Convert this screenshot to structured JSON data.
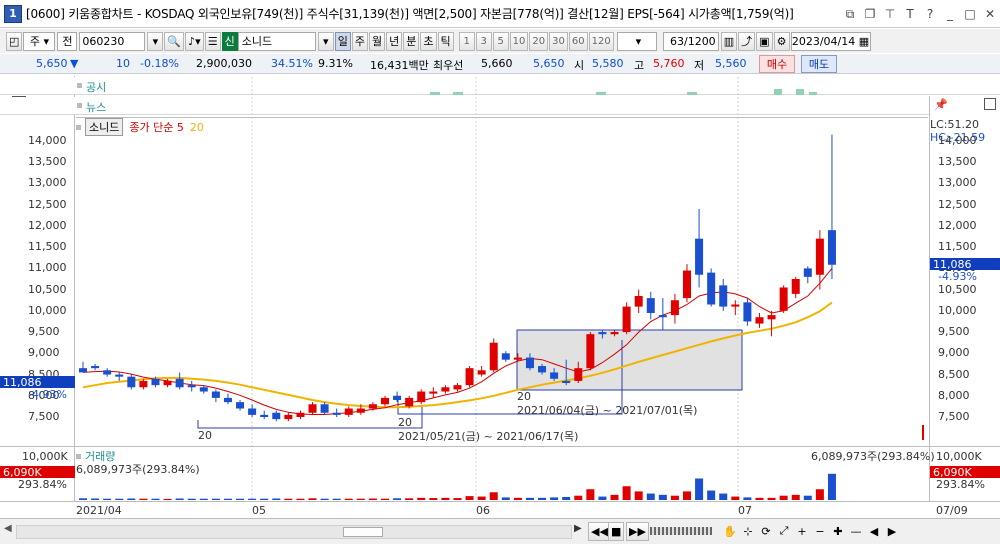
{
  "window": {
    "app_number": "1",
    "title": "[0600] 키움종합차트 - KOSDAQ 외국인보유[749(천)] 주식수[31,139(천)] 액면[2,500] 자본금[778(억)] 결산[12월] EPS[-564] 시가총액[1,759(억)]"
  },
  "toolbar": {
    "mode_primary": "주",
    "mode_secondary": "전",
    "code": "060230",
    "search_icon": "magnifier",
    "badge": "신",
    "stock_name": "소니드",
    "periods": [
      "일",
      "주",
      "월",
      "년",
      "분",
      "초",
      "틱"
    ],
    "active_period": "일",
    "intervals": [
      "1",
      "3",
      "5",
      "10",
      "20",
      "30",
      "60",
      "120"
    ],
    "count": "63",
    "count_max": "/1200",
    "date": "2023/04/14"
  },
  "quote": {
    "price": "5,650",
    "change_arrow": "▼",
    "change": "10",
    "change_pct": "-0.18%",
    "volume": "2,900,030",
    "turnover_pct": "34.51%",
    "foreign_pct": "9.31%",
    "amount": "16,431백만",
    "pref_label": "최우선",
    "pref_ask": "5,660",
    "pref_bid": "5,650",
    "open_label": "시",
    "open": "5,580",
    "high_label": "고",
    "high": "5,760",
    "low_label": "저",
    "low": "5,560",
    "buy": "매수",
    "sell": "매도"
  },
  "panels": {
    "notice_label": "공시",
    "news_label": "뉴스"
  },
  "legend": {
    "stock": "소니드",
    "ma_label": "종가 단순 5",
    "ma_second": "20",
    "ma5_color": "#d40000",
    "ma20_color": "#f0b400"
  },
  "right_labels": {
    "lc": "LC:51.20",
    "hc": "HC:-21.59",
    "price_tag": "11,086",
    "price_pct": "-4.93%",
    "vol_tag": "6,090K",
    "vol_pct": "293.84%"
  },
  "left_labels": {
    "price_tag": "11,086",
    "price_pct": "-4.93%",
    "vol_axis": "10,000K",
    "vol_tag": "6,090K",
    "vol_pct": "293.84%"
  },
  "volume_panel": {
    "label": "거래량",
    "readout": "6,089,973주(293.84%)",
    "right_readout": "6,089,973주(293.84%)"
  },
  "annotations": [
    {
      "count": "20",
      "range": "2021/05/21(금) ~ 2021/06/17(목)"
    },
    {
      "count": "20",
      "range": "2021/06/04(금) ~ 2021/07/01(목)"
    },
    {
      "count": "20",
      "range": ""
    }
  ],
  "x_axis": {
    "labels": [
      "2021/04",
      "05",
      "06",
      "07"
    ],
    "right_label": "07/09"
  },
  "price_ticks": [
    "14,000",
    "13,500",
    "13,000",
    "12,500",
    "12,000",
    "11,500",
    "11,000",
    "10,500",
    "10,000",
    "9,500",
    "9,000",
    "8,500",
    "8,000",
    "7,500"
  ],
  "chart_data": {
    "type": "candlestick",
    "title": "",
    "ylim": [
      7000,
      14300
    ],
    "up_color": "#e00000",
    "down_color": "#1a4fd0",
    "candles": [
      {
        "o": 8650,
        "h": 8800,
        "l": 8550,
        "c": 8550
      },
      {
        "o": 8700,
        "h": 8750,
        "l": 8600,
        "c": 8650
      },
      {
        "o": 8600,
        "h": 8650,
        "l": 8450,
        "c": 8500
      },
      {
        "o": 8500,
        "h": 8550,
        "l": 8350,
        "c": 8450
      },
      {
        "o": 8450,
        "h": 8500,
        "l": 8150,
        "c": 8200
      },
      {
        "o": 8200,
        "h": 8400,
        "l": 8150,
        "c": 8350
      },
      {
        "o": 8400,
        "h": 8450,
        "l": 8200,
        "c": 8250
      },
      {
        "o": 8250,
        "h": 8400,
        "l": 8200,
        "c": 8350
      },
      {
        "o": 8400,
        "h": 8550,
        "l": 8150,
        "c": 8200
      },
      {
        "o": 8250,
        "h": 8350,
        "l": 8100,
        "c": 8200
      },
      {
        "o": 8200,
        "h": 8250,
        "l": 8050,
        "c": 8100
      },
      {
        "o": 8100,
        "h": 8150,
        "l": 7850,
        "c": 7950
      },
      {
        "o": 7950,
        "h": 8050,
        "l": 7800,
        "c": 7850
      },
      {
        "o": 7850,
        "h": 7900,
        "l": 7650,
        "c": 7700
      },
      {
        "o": 7700,
        "h": 7800,
        "l": 7500,
        "c": 7550
      },
      {
        "o": 7550,
        "h": 7650,
        "l": 7450,
        "c": 7500
      },
      {
        "o": 7600,
        "h": 7650,
        "l": 7400,
        "c": 7450
      },
      {
        "o": 7450,
        "h": 7600,
        "l": 7400,
        "c": 7550
      },
      {
        "o": 7500,
        "h": 7650,
        "l": 7450,
        "c": 7600
      },
      {
        "o": 7600,
        "h": 7850,
        "l": 7550,
        "c": 7800
      },
      {
        "o": 7800,
        "h": 7850,
        "l": 7550,
        "c": 7600
      },
      {
        "o": 7600,
        "h": 7700,
        "l": 7500,
        "c": 7550
      },
      {
        "o": 7550,
        "h": 7750,
        "l": 7500,
        "c": 7700
      },
      {
        "o": 7600,
        "h": 7800,
        "l": 7550,
        "c": 7700
      },
      {
        "o": 7700,
        "h": 7850,
        "l": 7650,
        "c": 7800
      },
      {
        "o": 7800,
        "h": 8000,
        "l": 7750,
        "c": 7950
      },
      {
        "o": 8000,
        "h": 8100,
        "l": 7850,
        "c": 7900
      },
      {
        "o": 7750,
        "h": 8000,
        "l": 7700,
        "c": 7950
      },
      {
        "o": 7850,
        "h": 8150,
        "l": 7800,
        "c": 8100
      },
      {
        "o": 8050,
        "h": 8200,
        "l": 7950,
        "c": 8100
      },
      {
        "o": 8100,
        "h": 8250,
        "l": 8050,
        "c": 8200
      },
      {
        "o": 8150,
        "h": 8300,
        "l": 8100,
        "c": 8250
      },
      {
        "o": 8250,
        "h": 8700,
        "l": 8200,
        "c": 8650
      },
      {
        "o": 8500,
        "h": 8700,
        "l": 8450,
        "c": 8600
      },
      {
        "o": 8600,
        "h": 9350,
        "l": 8550,
        "c": 9250
      },
      {
        "o": 9000,
        "h": 9050,
        "l": 8800,
        "c": 8850
      },
      {
        "o": 8850,
        "h": 9000,
        "l": 8800,
        "c": 8900
      },
      {
        "o": 8900,
        "h": 9000,
        "l": 8600,
        "c": 8650
      },
      {
        "o": 8700,
        "h": 8750,
        "l": 8500,
        "c": 8550
      },
      {
        "o": 8550,
        "h": 8650,
        "l": 8350,
        "c": 8400
      },
      {
        "o": 8350,
        "h": 8850,
        "l": 8250,
        "c": 8300
      },
      {
        "o": 8350,
        "h": 8800,
        "l": 8300,
        "c": 8650
      },
      {
        "o": 8650,
        "h": 9500,
        "l": 8600,
        "c": 9450
      },
      {
        "o": 9500,
        "h": 9550,
        "l": 9350,
        "c": 9450
      },
      {
        "o": 9450,
        "h": 9550,
        "l": 9400,
        "c": 9500
      },
      {
        "o": 9500,
        "h": 10200,
        "l": 9450,
        "c": 10100
      },
      {
        "o": 10100,
        "h": 10500,
        "l": 9950,
        "c": 10350
      },
      {
        "o": 10300,
        "h": 10450,
        "l": 9800,
        "c": 9950
      },
      {
        "o": 9900,
        "h": 10300,
        "l": 9550,
        "c": 9850
      },
      {
        "o": 9900,
        "h": 10400,
        "l": 9700,
        "c": 10250
      },
      {
        "o": 10300,
        "h": 11100,
        "l": 10200,
        "c": 10950
      },
      {
        "o": 11700,
        "h": 12400,
        "l": 10550,
        "c": 10850
      },
      {
        "o": 10900,
        "h": 11000,
        "l": 10100,
        "c": 10150
      },
      {
        "o": 10600,
        "h": 10750,
        "l": 10000,
        "c": 10100
      },
      {
        "o": 10100,
        "h": 10250,
        "l": 9900,
        "c": 10150
      },
      {
        "o": 10200,
        "h": 10300,
        "l": 9650,
        "c": 9750
      },
      {
        "o": 9700,
        "h": 9950,
        "l": 9600,
        "c": 9850
      },
      {
        "o": 9800,
        "h": 10000,
        "l": 9400,
        "c": 9900
      },
      {
        "o": 10000,
        "h": 10600,
        "l": 9950,
        "c": 10550
      },
      {
        "o": 10400,
        "h": 10800,
        "l": 10300,
        "c": 10750
      },
      {
        "o": 11000,
        "h": 11050,
        "l": 10650,
        "c": 10800
      },
      {
        "o": 10850,
        "h": 11900,
        "l": 10500,
        "c": 11700
      },
      {
        "o": 11900,
        "h": 14150,
        "l": 10750,
        "c": 11086
      }
    ],
    "ma5": [
      8550,
      8570,
      8580,
      8560,
      8510,
      8440,
      8390,
      8350,
      8300,
      8260,
      8240,
      8180,
      8100,
      8010,
      7900,
      7780,
      7680,
      7610,
      7570,
      7560,
      7560,
      7580,
      7600,
      7640,
      7680,
      7720,
      7790,
      7840,
      7880,
      7950,
      8020,
      8080,
      8180,
      8330,
      8530,
      8700,
      8820,
      8880,
      8850,
      8750,
      8650,
      8560,
      8620,
      8780,
      8980,
      9200,
      9500,
      9750,
      9900,
      10000,
      10150,
      10350,
      10420,
      10450,
      10400,
      10300,
      10100,
      9950,
      10000,
      10180,
      10350,
      10650,
      11000
    ],
    "ma20": [
      8200,
      8250,
      8300,
      8330,
      8360,
      8390,
      8410,
      8420,
      8420,
      8400,
      8380,
      8350,
      8310,
      8260,
      8200,
      8140,
      8080,
      8020,
      7960,
      7900,
      7850,
      7810,
      7780,
      7760,
      7740,
      7730,
      7730,
      7740,
      7760,
      7780,
      7810,
      7850,
      7890,
      7940,
      8000,
      8070,
      8140,
      8200,
      8260,
      8310,
      8360,
      8410,
      8470,
      8540,
      8620,
      8710,
      8800,
      8880,
      8960,
      9040,
      9120,
      9200,
      9280,
      9350,
      9420,
      9480,
      9530,
      9580,
      9650,
      9730,
      9850,
      9990,
      10200
    ],
    "volume": [
      0.4,
      0.35,
      0.3,
      0.3,
      0.35,
      0.3,
      0.3,
      0.25,
      0.35,
      0.3,
      0.3,
      0.3,
      0.3,
      0.3,
      0.3,
      0.3,
      0.35,
      0.3,
      0.3,
      0.4,
      0.3,
      0.3,
      0.3,
      0.3,
      0.35,
      0.3,
      0.4,
      0.4,
      0.5,
      0.45,
      0.5,
      0.45,
      0.9,
      0.8,
      1.8,
      0.6,
      0.5,
      0.5,
      0.5,
      0.6,
      0.7,
      1.0,
      2.5,
      0.8,
      1.2,
      3.2,
      2.0,
      1.5,
      1.2,
      1.0,
      2.0,
      5.0,
      2.2,
      1.5,
      0.8,
      0.6,
      0.5,
      0.5,
      1.0,
      1.2,
      1.0,
      2.5,
      6.09
    ],
    "volume_unit": "M shares",
    "volume_ylim": [
      0,
      10
    ]
  }
}
